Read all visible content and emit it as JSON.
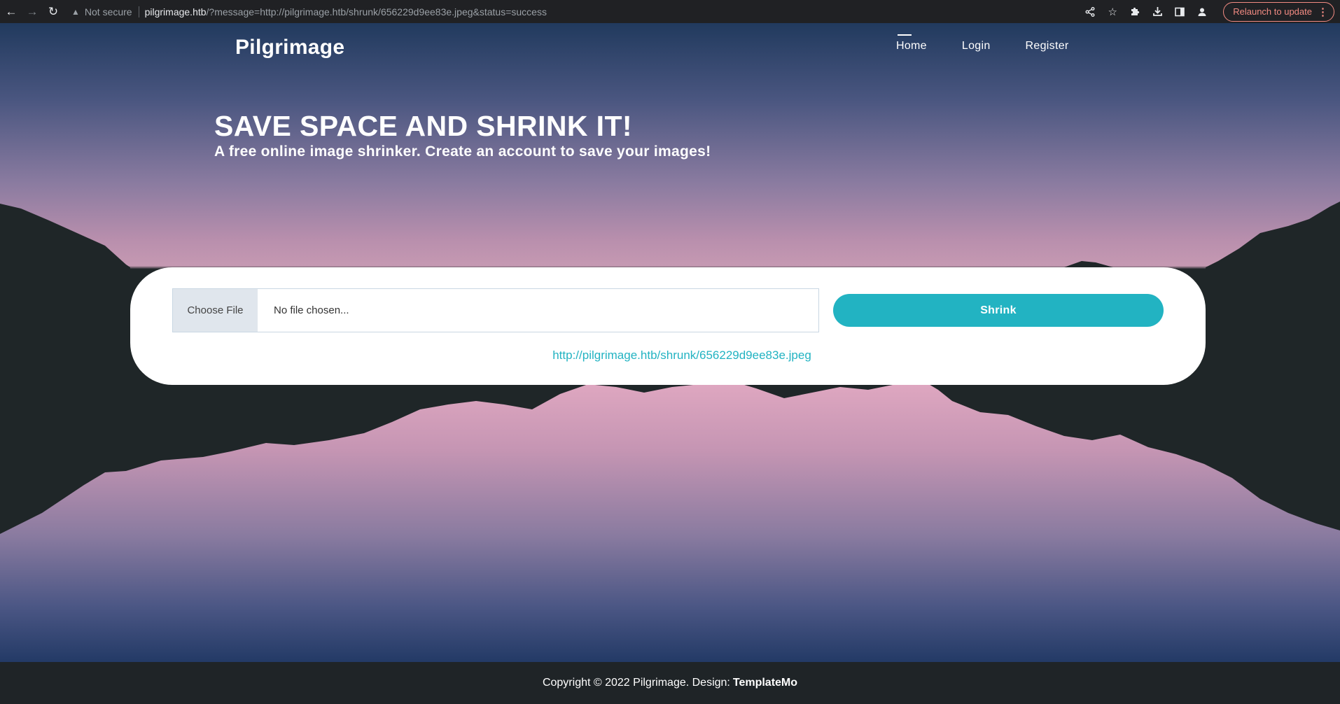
{
  "browser": {
    "back_icon": "arrow-left-icon",
    "forward_icon": "arrow-right-icon",
    "reload_icon": "reload-icon",
    "security_label": "Not secure",
    "url_host": "pilgrimage.htb",
    "url_rest": "/?message=http://pilgrimage.htb/shrunk/656229d9ee83e.jpeg&status=success",
    "relaunch_label": "Relaunch to update",
    "accent_color": "#f28b82"
  },
  "header": {
    "brand": "Pilgrimage",
    "nav": [
      {
        "label": "Home",
        "active": true
      },
      {
        "label": "Login",
        "active": false
      },
      {
        "label": "Register",
        "active": false
      }
    ]
  },
  "hero": {
    "title": "SAVE SPACE AND SHRINK IT!",
    "subtitle": "A free online image shrinker. Create an account to save your images!"
  },
  "upload": {
    "choose_label": "Choose File",
    "file_status": "No file chosen...",
    "submit_label": "Shrink",
    "result_url": "http://pilgrimage.htb/shrunk/656229d9ee83e.jpeg",
    "accent_color": "#22b3c2"
  },
  "footer": {
    "copyright": "Copyright © 2022 Pilgrimage. Design:",
    "design_link": "TemplateMo"
  }
}
